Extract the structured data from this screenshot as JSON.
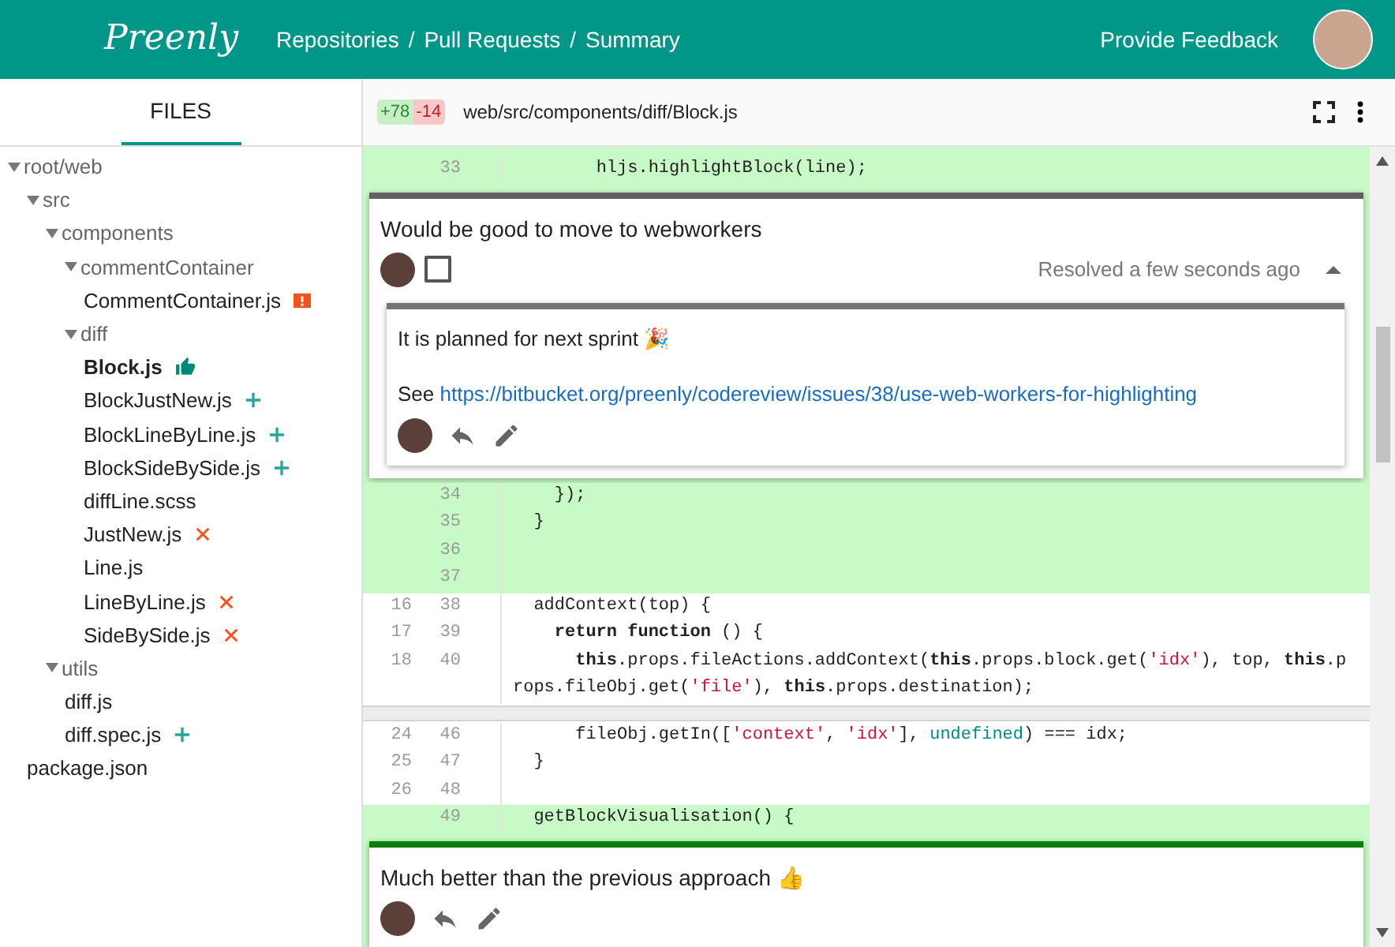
{
  "header": {
    "logo": "Preenly",
    "breadcrumbs": [
      {
        "kind": "link",
        "label": "Repositories"
      },
      {
        "kind": "separator",
        "label": "/"
      },
      {
        "kind": "link",
        "label": "Pull Requests"
      },
      {
        "kind": "separator",
        "label": "/"
      },
      {
        "kind": "link",
        "label": "Summary"
      }
    ],
    "feedback": "Provide Feedback"
  },
  "sidebar": {
    "tab": {
      "label": "FILES",
      "selected": true
    },
    "tree": [
      {
        "kind": "folder",
        "name": "root/web",
        "expanded": true,
        "children": [
          {
            "kind": "folder",
            "name": "src",
            "expanded": true,
            "children": [
              {
                "kind": "folder",
                "name": "components",
                "expanded": true,
                "children": [
                  {
                    "kind": "folder",
                    "name": "commentContainer",
                    "expanded": true,
                    "children": [
                      {
                        "kind": "commented",
                        "name": "CommentContainer.js",
                        "selected": false
                      }
                    ]
                  },
                  {
                    "kind": "folder",
                    "name": "diff",
                    "expanded": true,
                    "children": [
                      {
                        "kind": "approved",
                        "name": "Block.js",
                        "selected": true
                      },
                      {
                        "kind": "added",
                        "name": "BlockJustNew.js",
                        "selected": false
                      },
                      {
                        "kind": "added",
                        "name": "BlockLineByLine.js",
                        "selected": false
                      },
                      {
                        "kind": "added",
                        "name": "BlockSideBySide.js",
                        "selected": false
                      },
                      {
                        "kind": "file",
                        "name": "diffLine.scss",
                        "selected": false
                      },
                      {
                        "kind": "deleted",
                        "name": "JustNew.js",
                        "selected": false
                      },
                      {
                        "kind": "file",
                        "name": "Line.js",
                        "selected": false
                      },
                      {
                        "kind": "deleted",
                        "name": "LineByLine.js",
                        "selected": false
                      },
                      {
                        "kind": "deleted",
                        "name": "SideBySide.js",
                        "selected": false
                      }
                    ]
                  }
                ]
              },
              {
                "kind": "folder",
                "name": "utils",
                "expanded": true,
                "children": [
                  {
                    "kind": "file",
                    "name": "diff.js",
                    "selected": false
                  },
                  {
                    "kind": "added",
                    "name": "diff.spec.js",
                    "selected": false
                  }
                ]
              }
            ]
          },
          {
            "kind": "file",
            "name": "package.json",
            "selected": false
          }
        ]
      }
    ]
  },
  "file": {
    "added": "+78",
    "removed": "-14",
    "path": "web/src/components/diff/Block.js"
  },
  "diff": [
    {
      "kind": "added",
      "new": "33",
      "code": [
        {
          "kind": "plain",
          "s": "        hljs.highlightBlock(line);"
        }
      ]
    },
    {
      "kind": "comment",
      "color": "#616161",
      "text": "Would be good to move to webworkers",
      "checked": false,
      "status": "Resolved a few seconds ago",
      "expanded": true,
      "replies": [
        {
          "color": "#757575",
          "paragraphs": [
            {
              "text": "It is planned for next sprint 🎉"
            },
            {
              "text": "See ",
              "link": "https://bitbucket.org/preenly/codereview/issues/38/use-web-workers-for-highlighting"
            }
          ],
          "actions": [
            {
              "kind": "reply"
            },
            {
              "kind": "edit"
            }
          ]
        }
      ]
    },
    {
      "kind": "added",
      "new": "34",
      "code": [
        {
          "kind": "plain",
          "s": "    });"
        }
      ]
    },
    {
      "kind": "added",
      "new": "35",
      "code": [
        {
          "kind": "plain",
          "s": "  }"
        }
      ]
    },
    {
      "kind": "added",
      "new": "36"
    },
    {
      "kind": "added",
      "new": "37"
    },
    {
      "kind": "context",
      "old": "16",
      "new": "38",
      "code": [
        {
          "kind": "plain",
          "s": "  addContext(top) {"
        }
      ]
    },
    {
      "kind": "context",
      "old": "17",
      "new": "39",
      "code": [
        {
          "kind": "keyword",
          "s": "    return function"
        },
        {
          "kind": "plain",
          "s": " () {"
        }
      ]
    },
    {
      "kind": "context",
      "old": "18",
      "new": "40",
      "code": [
        {
          "kind": "keyword",
          "s": "      this"
        },
        {
          "kind": "plain",
          "s": ".props.fileActions.addContext("
        },
        {
          "kind": "keyword",
          "s": "this"
        },
        {
          "kind": "plain",
          "s": ".props.block.get("
        },
        {
          "kind": "string",
          "s": "'idx'"
        },
        {
          "kind": "plain",
          "s": "), top, "
        },
        {
          "kind": "keyword",
          "s": "this"
        },
        {
          "kind": "plain",
          "s": ".props.fileObj.get("
        },
        {
          "kind": "string",
          "s": "'file'"
        },
        {
          "kind": "plain",
          "s": "), "
        },
        {
          "kind": "keyword",
          "s": "this"
        },
        {
          "kind": "plain",
          "s": ".props.destination);"
        }
      ]
    },
    {
      "kind": "gap"
    },
    {
      "kind": "context",
      "old": "24",
      "new": "46",
      "code": [
        {
          "kind": "plain",
          "s": "      fileObj.getIn(["
        },
        {
          "kind": "string",
          "s": "'context'"
        },
        {
          "kind": "plain",
          "s": ", "
        },
        {
          "kind": "string",
          "s": "'idx'"
        },
        {
          "kind": "plain",
          "s": "], "
        },
        {
          "kind": "literal",
          "s": "undefined"
        },
        {
          "kind": "plain",
          "s": ") === idx;"
        }
      ]
    },
    {
      "kind": "context",
      "old": "25",
      "new": "47",
      "code": [
        {
          "kind": "plain",
          "s": "  }"
        }
      ]
    },
    {
      "kind": "context",
      "old": "26",
      "new": "48"
    },
    {
      "kind": "added",
      "new": "49",
      "code": [
        {
          "kind": "plain",
          "s": "  getBlockVisualisation() {"
        }
      ]
    },
    {
      "kind": "comment",
      "color": "#0a7d0a",
      "text": "Much better than the previous approach 👍",
      "actions": [
        {
          "kind": "reply"
        },
        {
          "kind": "edit"
        }
      ]
    }
  ]
}
